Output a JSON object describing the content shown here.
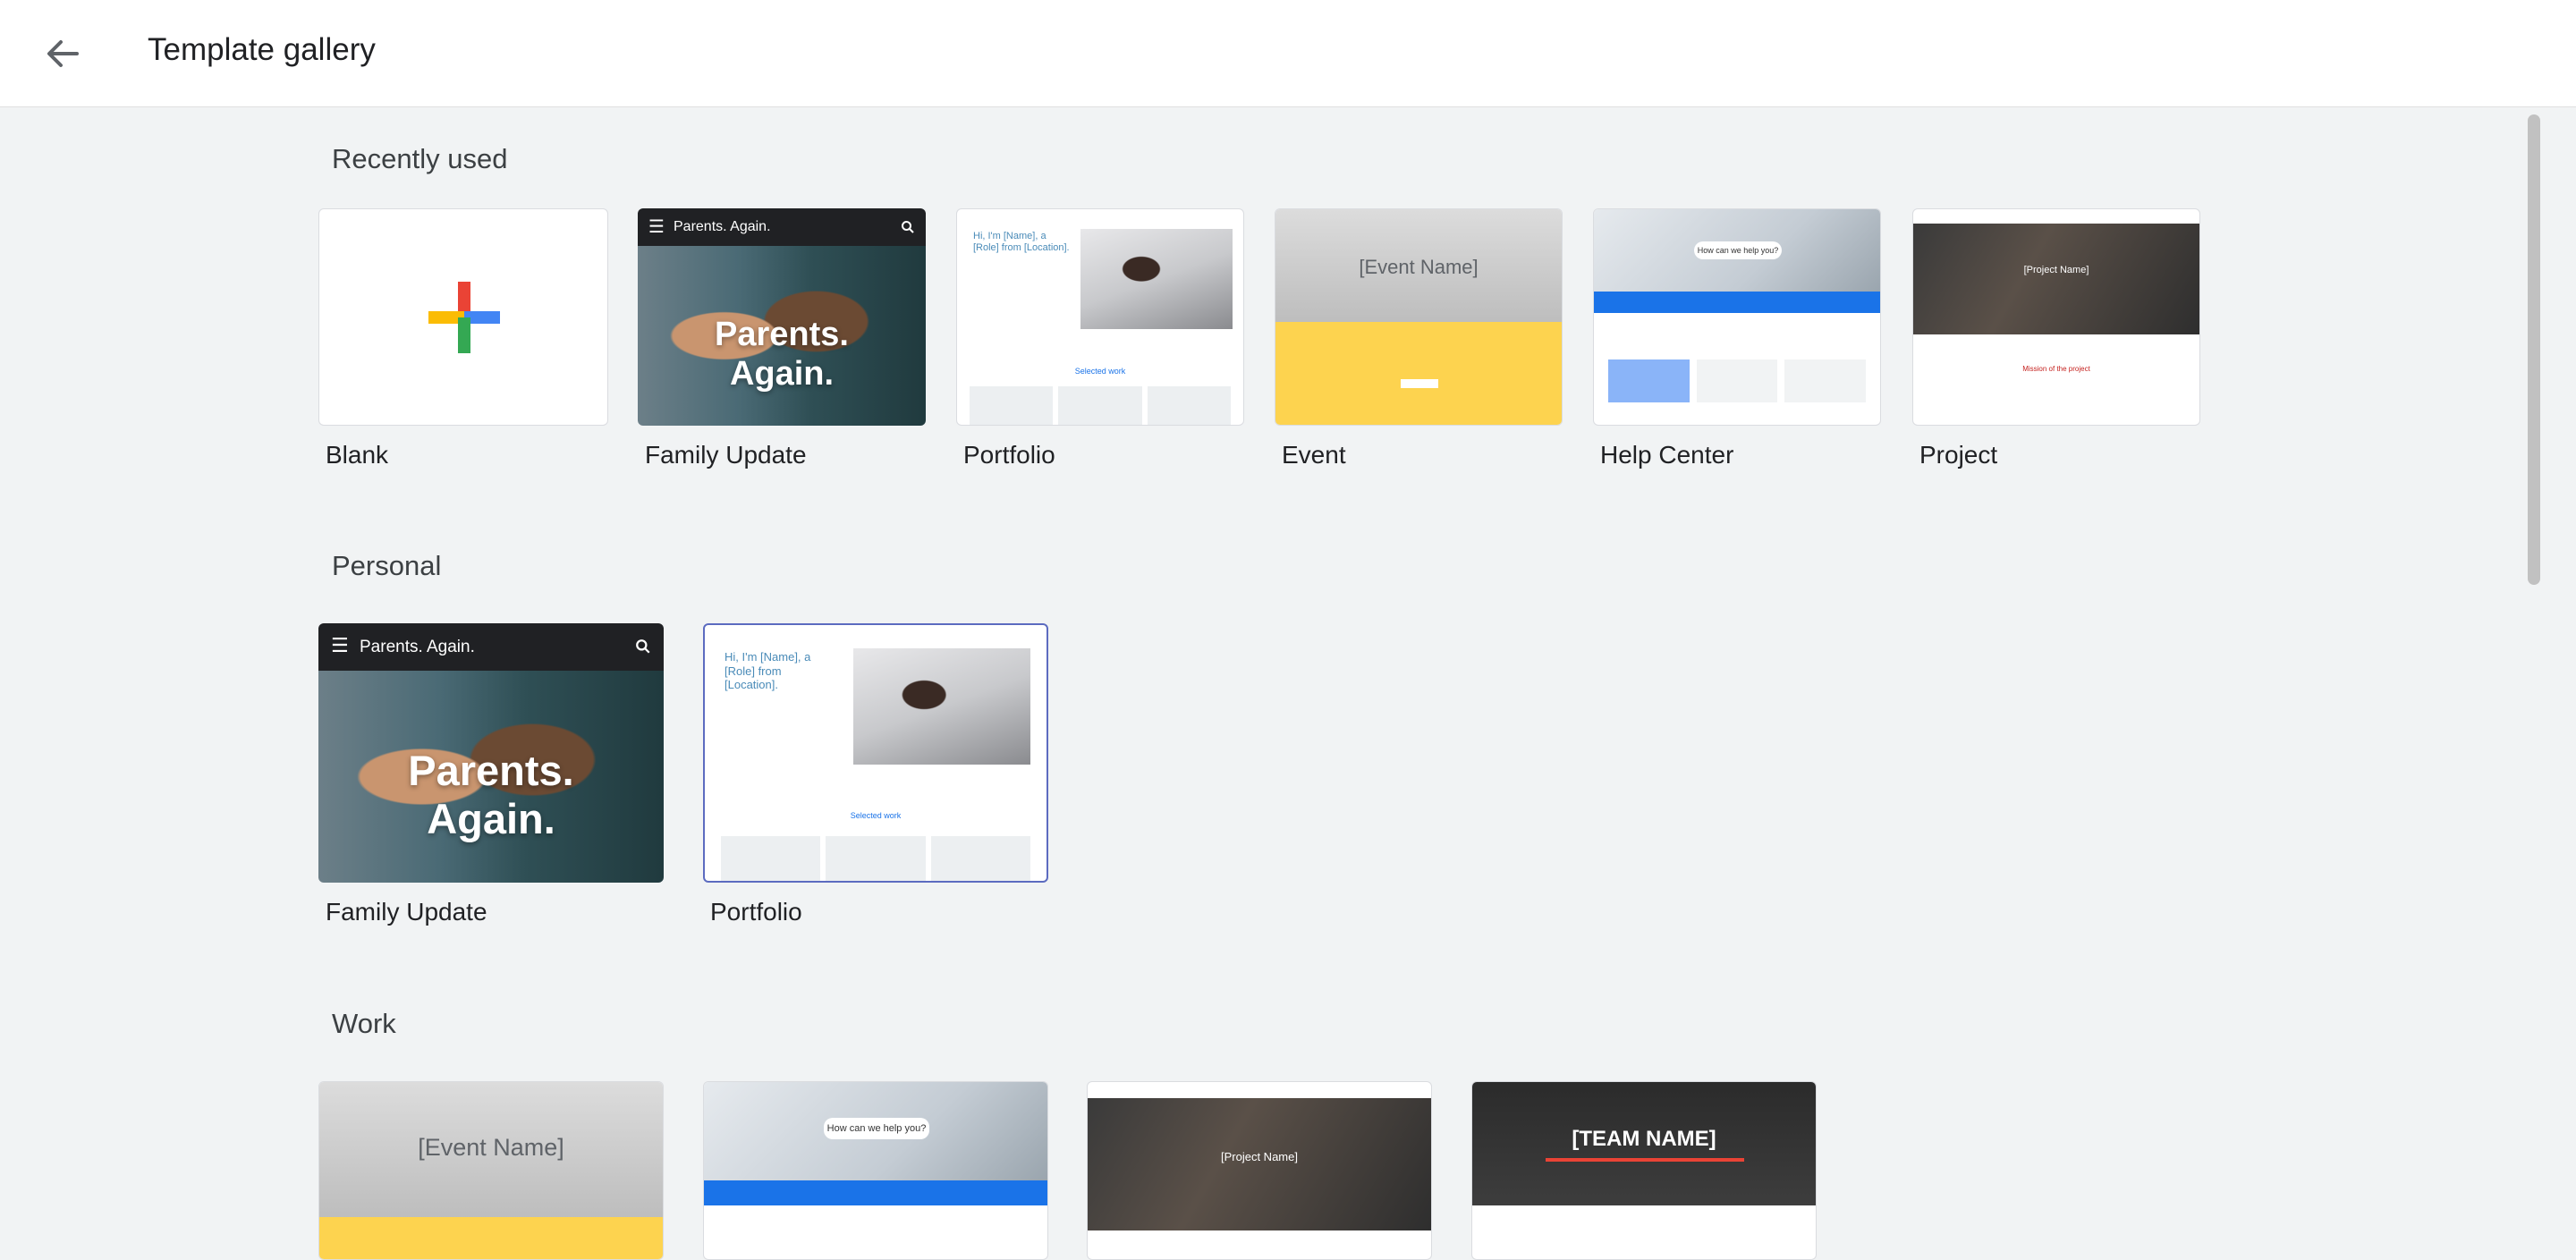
{
  "header": {
    "title": "Template gallery",
    "back_icon": "arrow-back-icon"
  },
  "sections": {
    "recently_used": {
      "title": "Recently used"
    },
    "personal": {
      "title": "Personal"
    },
    "work": {
      "title": "Work"
    }
  },
  "templates": {
    "blank": {
      "label": "Blank"
    },
    "family_update": {
      "label": "Family Update",
      "brand": "Parents. Again.",
      "headline_1": "Parents.",
      "headline_2": "Again."
    },
    "portfolio": {
      "label": "Portfolio",
      "intro": "Hi, I'm [Name], a [Role] from [Location].",
      "selected": "Selected work"
    },
    "event": {
      "label": "Event",
      "name": "[Event Name]"
    },
    "help_center": {
      "label": "Help Center",
      "question": "How can we help you?"
    },
    "project": {
      "label": "Project",
      "name": "[Project Name]",
      "mission": "Mission of the project"
    },
    "team": {
      "name": "[TEAM NAME]"
    }
  },
  "colors": {
    "google_red": "#ea4335",
    "google_yellow": "#fbbc04",
    "google_blue": "#4285f4",
    "google_green": "#34a853",
    "event_yellow": "#fdd34f",
    "help_blue": "#1a73e8"
  }
}
